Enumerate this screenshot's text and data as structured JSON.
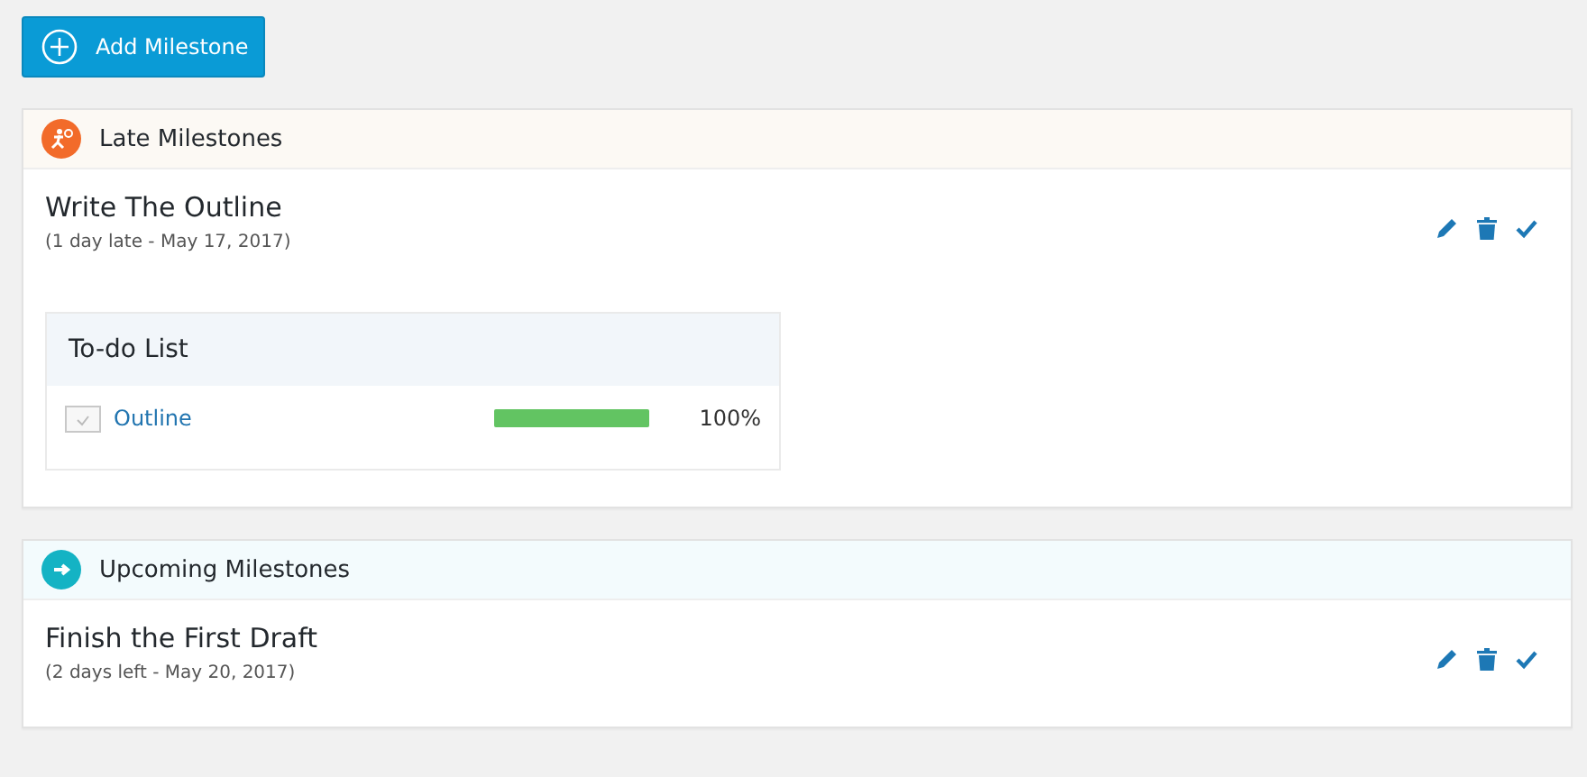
{
  "add_button": {
    "label": "Add Milestone"
  },
  "sections": [
    {
      "kind": "late",
      "title": "Late Milestones",
      "milestones": [
        {
          "title": "Write The Outline",
          "due": "(1 day late - May 17, 2017)",
          "todo_list": {
            "title": "To-do List",
            "items": [
              {
                "label": "Outline",
                "level": 1,
                "reading": "100%"
              }
            ]
          }
        }
      ]
    },
    {
      "kind": "upcoming",
      "title": "Upcoming Milestones",
      "milestones": [
        {
          "title": "Finish the First Draft",
          "due": "(2 days left - May 20, 2017)"
        }
      ]
    }
  ]
}
